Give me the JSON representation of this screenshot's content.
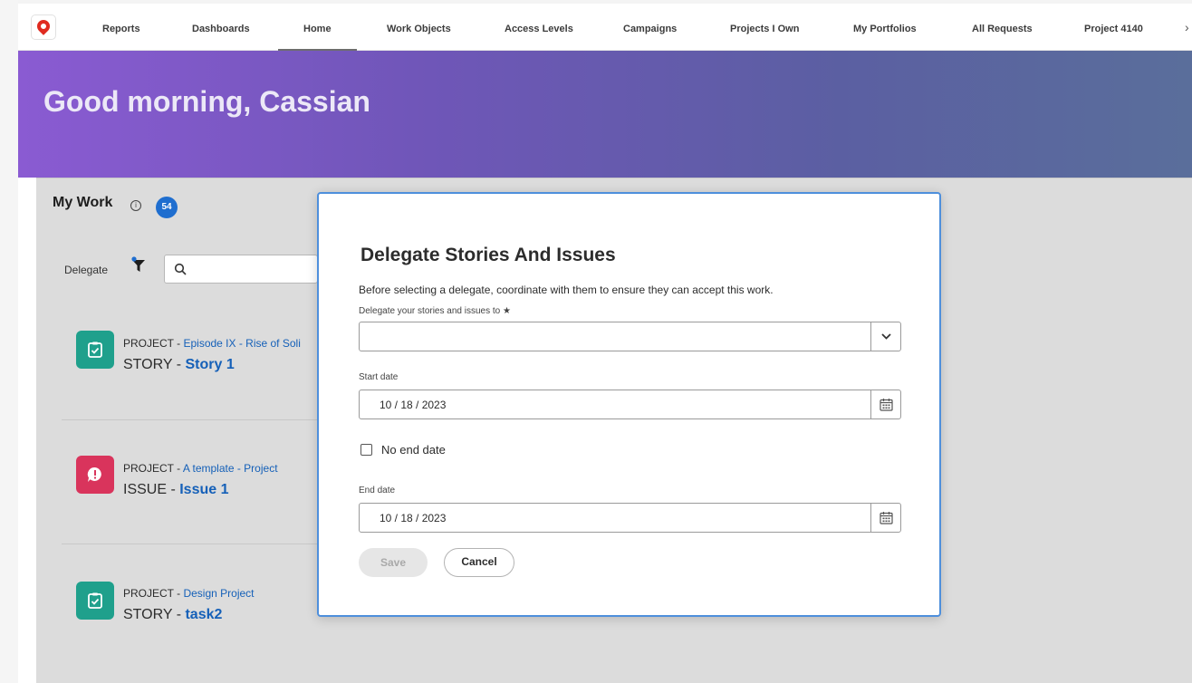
{
  "nav": {
    "items": [
      {
        "label": "Reports"
      },
      {
        "label": "Dashboards"
      },
      {
        "label": "Home"
      },
      {
        "label": "Work Objects"
      },
      {
        "label": "Access Levels"
      },
      {
        "label": "Campaigns"
      },
      {
        "label": "Projects I Own"
      },
      {
        "label": "My Portfolios"
      },
      {
        "label": "All Requests"
      },
      {
        "label": "Project 4140"
      }
    ],
    "active": "Home"
  },
  "hero": {
    "greeting": "Good morning, Cassian"
  },
  "my_work": {
    "title": "My Work",
    "count": "54",
    "delegate_label": "Delegate",
    "items": [
      {
        "type_label": "PROJECT",
        "project": "Episode IX - Rise of Soli",
        "kind": "STORY",
        "name": "Story 1",
        "icon": "story-icon"
      },
      {
        "type_label": "PROJECT",
        "project": "A template - Project",
        "kind": "ISSUE",
        "name": "Issue 1",
        "icon": "issue-icon"
      },
      {
        "type_label": "PROJECT",
        "project": "Design Project",
        "kind": "STORY",
        "name": "task2",
        "icon": "story-icon"
      }
    ]
  },
  "modal": {
    "title": "Delegate Stories And Issues",
    "description": "Before selecting a delegate, coordinate with them to ensure they can accept this work.",
    "delegate_field_label": "Delegate your stories and issues to ★",
    "delegate_value": "",
    "start_date_label": "Start date",
    "start_date_value": "10 / 18 / 2023",
    "no_end_date_label": "No end date",
    "no_end_date_checked": false,
    "end_date_label": "End date",
    "end_date_value": "10 / 18 / 2023",
    "save_label": "Save",
    "cancel_label": "Cancel"
  },
  "colors": {
    "accent": "#1560b8",
    "hero_start": "#8a5bd2",
    "hero_end": "#5a6e9b",
    "story": "#1fa08c",
    "issue": "#d9345c",
    "modal_border": "#4e8fdc"
  }
}
